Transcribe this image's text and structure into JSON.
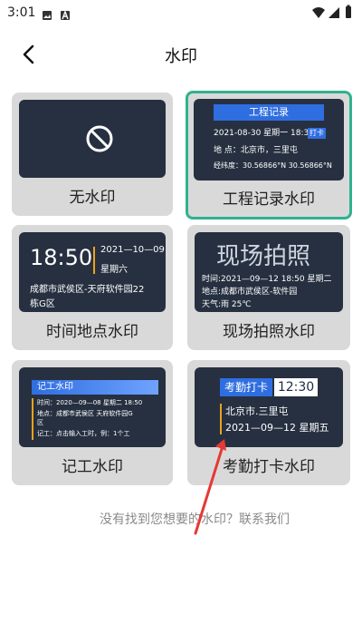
{
  "status": {
    "time": "3:01"
  },
  "header": {
    "title": "水印",
    "back_symbol": "<"
  },
  "cards": [
    {
      "label": "无水印"
    },
    {
      "label": "工程记录水印"
    },
    {
      "label": "时间地点水印"
    },
    {
      "label": "现场拍照水印"
    },
    {
      "label": "记工水印"
    },
    {
      "label": "考勤打卡水印"
    }
  ],
  "previews": {
    "project": {
      "header": "工程记录",
      "line1": "2021-08-30 星期一 18:33",
      "checkin_badge": "打卡",
      "line2": "地  点：北京市，三里屯",
      "line3": "经纬度：30.56866°N  30.56866°N"
    },
    "timeplace": {
      "time": "18:50",
      "date": "2021—10—09",
      "weekday": "星期六",
      "addr1": "成都市武侯区-天府软件园22",
      "addr2": "栋G区"
    },
    "scene": {
      "header": "现场拍照",
      "l1": "时间:2021—09—12 18:50  星期二",
      "l2": "地点:成都市武侯区-软件园",
      "l3": "天气:雨 25℃"
    },
    "work": {
      "header": "记工水印",
      "r1": "时间：2020—09—08 星期二 18:50",
      "r2a": "地点：成都市武侯区 天府软件园G",
      "r2b": "区",
      "r3": "记工：点击输入工时，例：1个工"
    },
    "attendance": {
      "badge": "考勤打卡",
      "time": "12:30",
      "place": "北京市.三里屯",
      "date": "2021—09—12 星期五"
    }
  },
  "footer": {
    "caption": "没有找到您想要的水印？联系我们"
  }
}
